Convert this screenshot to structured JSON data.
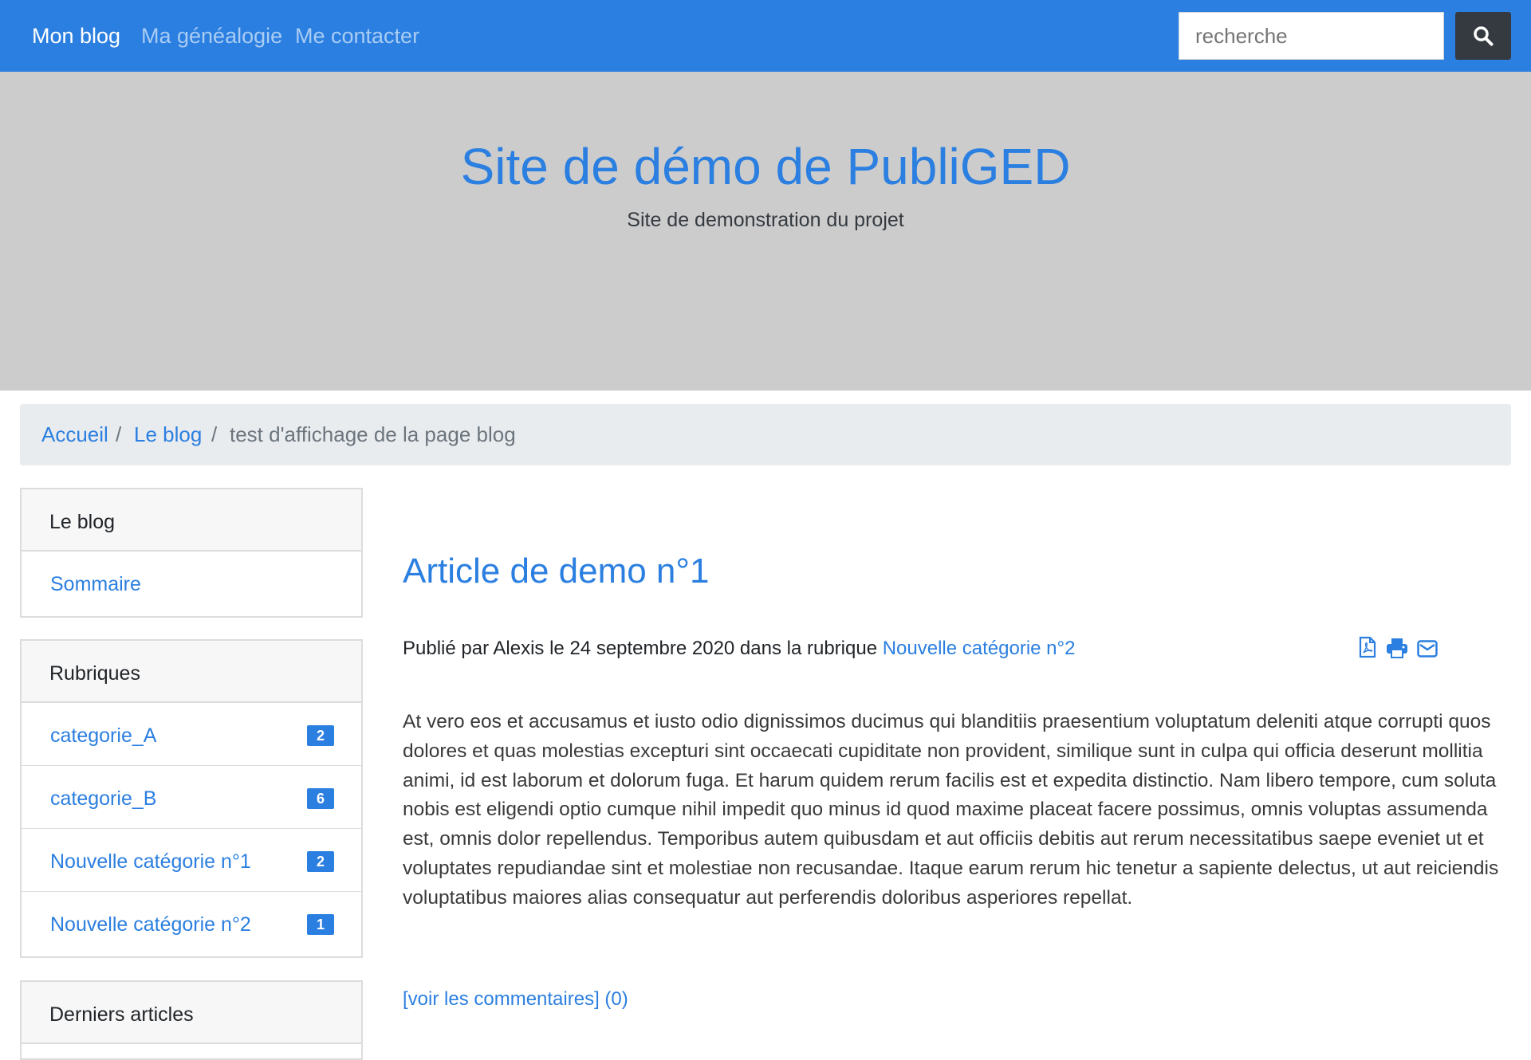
{
  "navbar": {
    "brand": "Mon blog",
    "links": [
      "Ma généalogie",
      "Me contacter"
    ],
    "search": {
      "placeholder": "recherche",
      "value": ""
    },
    "search_button_icon": "search-icon"
  },
  "hero": {
    "title": "Site de démo de PubliGED",
    "subtitle": "Site de demonstration du projet"
  },
  "breadcrumb": {
    "items": [
      "Accueil",
      "Le blog"
    ],
    "separator": "/",
    "current": "test d'affichage de la page blog"
  },
  "sidebar": {
    "blog_card": {
      "header": "Le blog",
      "items": [
        "Sommaire"
      ]
    },
    "rubriques_card": {
      "header": "Rubriques",
      "items": [
        {
          "label": "categorie_A",
          "count": "2"
        },
        {
          "label": "categorie_B",
          "count": "6"
        },
        {
          "label": "Nouvelle catégorie n°1",
          "count": "2"
        },
        {
          "label": "Nouvelle catégorie n°2",
          "count": "1"
        }
      ]
    },
    "recent_card": {
      "header": "Derniers articles"
    }
  },
  "article": {
    "title": "Article de demo n°1",
    "meta_prefix": "Publié par Alexis le 24 septembre 2020 dans la rubrique ",
    "meta_category": "Nouvelle catégorie n°2",
    "tools": [
      "pdf-icon",
      "print-icon",
      "email-icon"
    ],
    "body": "At vero eos et accusamus et iusto odio dignissimos ducimus qui blanditiis praesentium voluptatum deleniti atque corrupti quos dolores et quas molestias excepturi sint occaecati cupiditate non provident, similique sunt in culpa qui officia deserunt mollitia animi, id est laborum et dolorum fuga. Et harum quidem rerum facilis est et expedita distinctio. Nam libero tempore, cum soluta nobis est eligendi optio cumque nihil impedit quo minus id quod maxime placeat facere possimus, omnis voluptas assumenda est, omnis dolor repellendus. Temporibus autem quibusdam et aut officiis debitis aut rerum necessitatibus saepe eveniet ut et voluptates repudiandae sint et molestiae non recusandae. Itaque earum rerum hic tenetur a sapiente delectus, ut aut reiciendis voluptatibus maiores alias consequatur aut perferendis doloribus asperiores repellat.",
    "comments_link": "[voir les commentaires] (0)"
  },
  "colors": {
    "primary": "#2b7fe0",
    "navbar_link": "#a9ccf4",
    "hero_bg": "#cccccc",
    "breadcrumb_bg": "#e9ecef",
    "search_button_bg": "#343a40"
  }
}
